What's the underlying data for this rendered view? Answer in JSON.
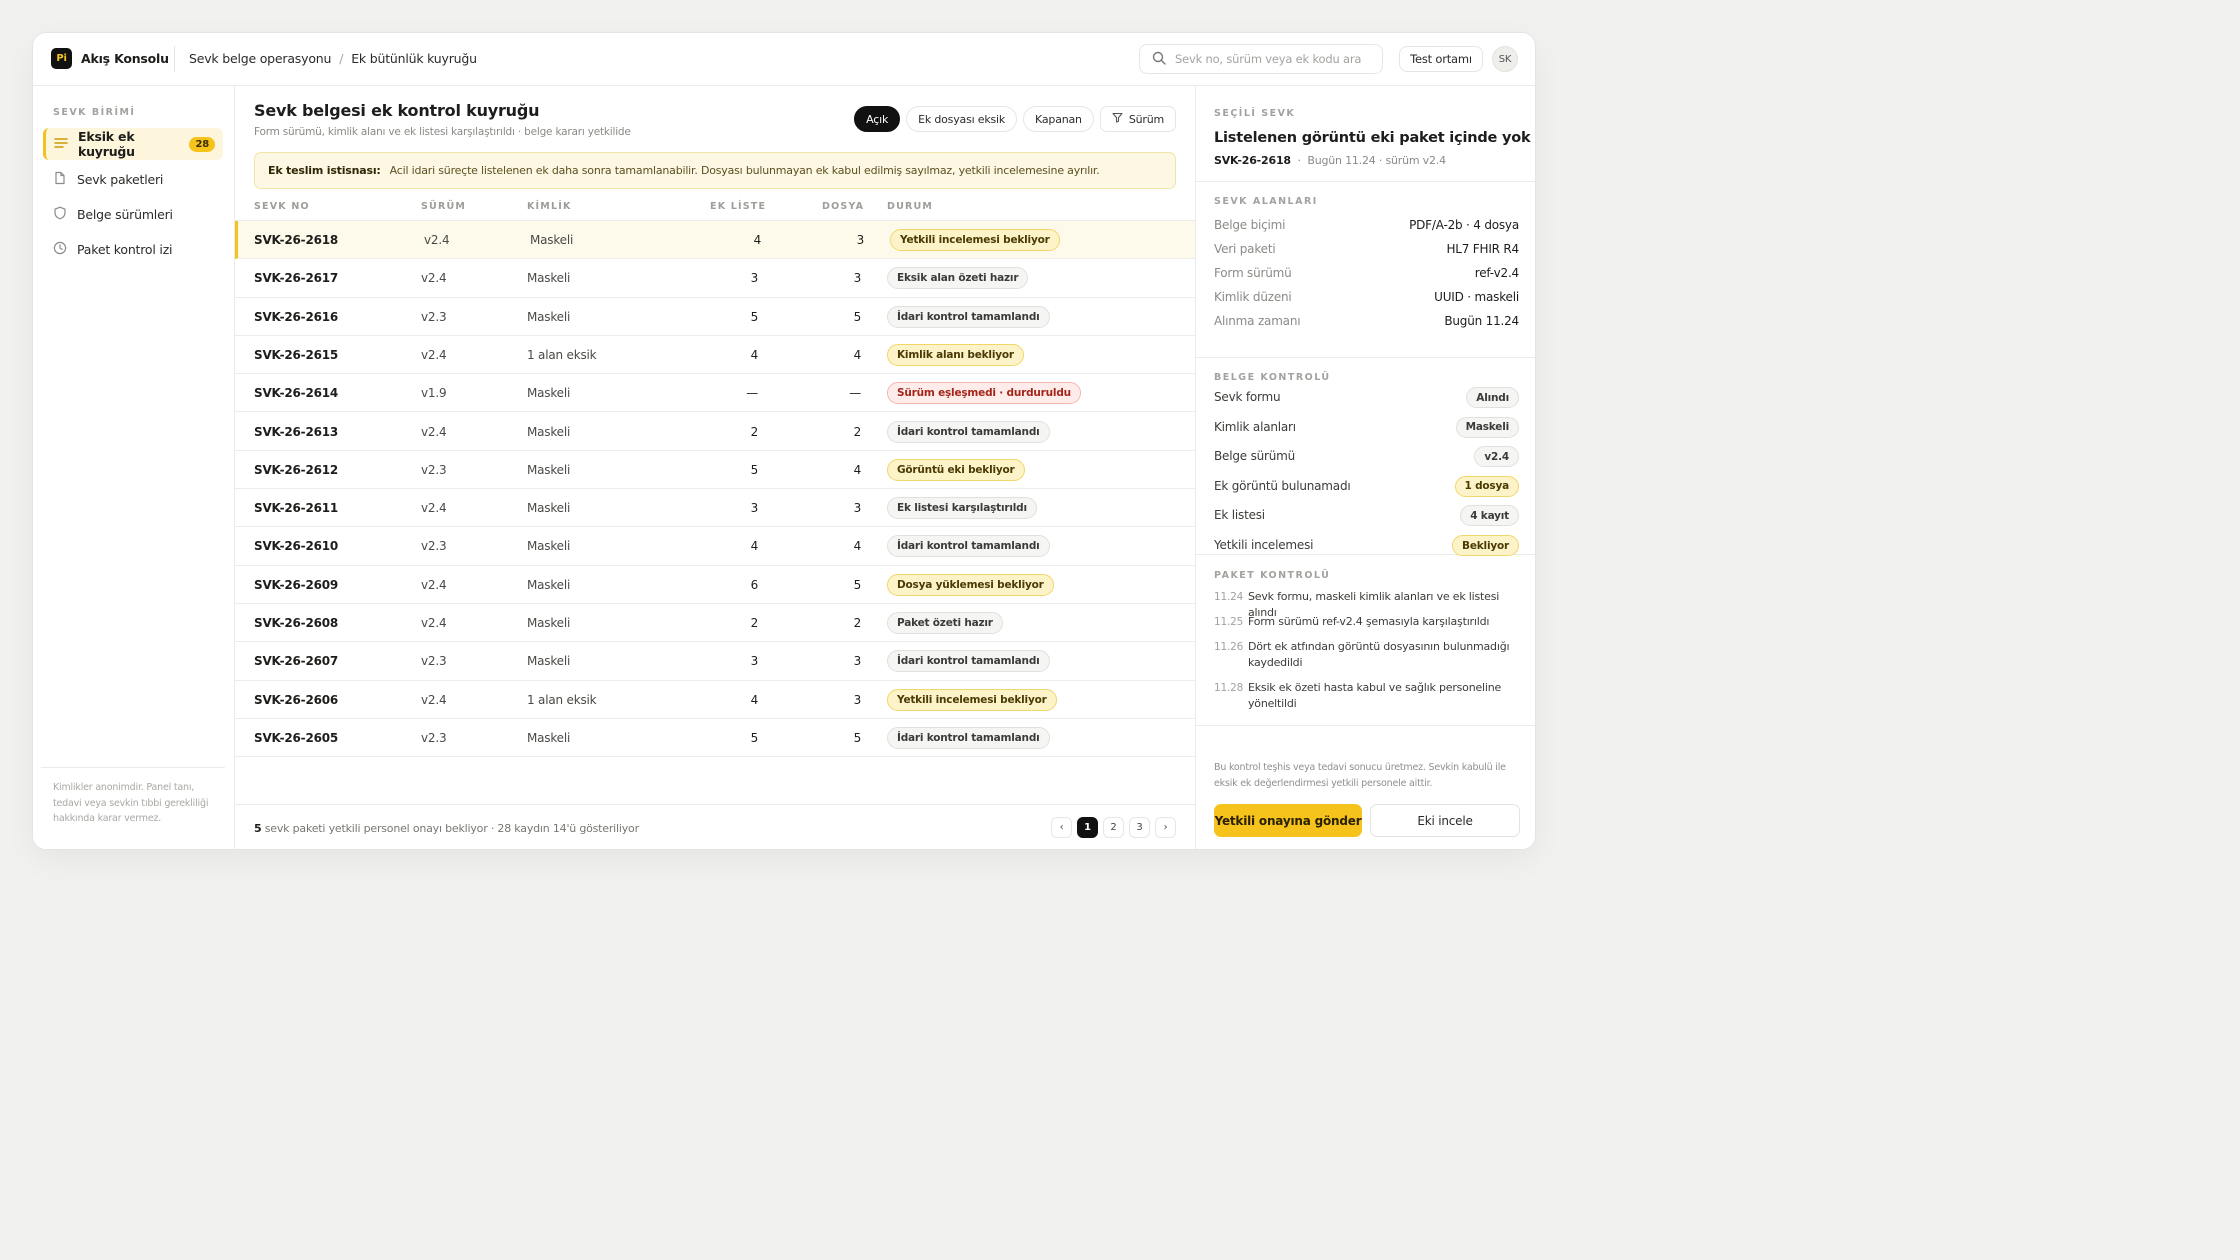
{
  "app": {
    "logo": "Pi",
    "name": "Akış Konsolu"
  },
  "breadcrumb": [
    "Sevk belge operasyonu",
    "/",
    "Ek bütünlük kuyruğu"
  ],
  "search": {
    "placeholder": "Sevk no, sürüm veya ek kodu ara"
  },
  "env_button": "Test ortamı",
  "user_initials": "SK",
  "sidebar": {
    "section": "SEVK BİRİMİ",
    "items": [
      {
        "label": "Eksik ek kuyruğu",
        "count": "28",
        "icon": "list-icon"
      },
      {
        "label": "Sevk paketleri",
        "icon": "document-icon"
      },
      {
        "label": "Belge sürümleri",
        "icon": "shield-icon"
      },
      {
        "label": "Paket kontrol izi",
        "icon": "clock-icon"
      }
    ],
    "footer": "Kimlikler anonimdir. Panel tanı, tedavi veya sevkin tıbbi gerekliliği hakkında karar vermez."
  },
  "main": {
    "title": "Sevk belgesi ek kontrol kuyruğu",
    "subtitle": "Form sürümü, kimlik alanı ve ek listesi karşılaştırıldı · belge kararı yetkilide",
    "filters": [
      "Açık",
      "Ek dosyası eksik",
      "Kapanan",
      "Sürüm"
    ],
    "banner": {
      "label": "Ek teslim istisnası:",
      "text": "Acil idari süreçte listelenen ek daha sonra tamamlanabilir. Dosyası bulunmayan ek kabul edilmiş sayılmaz, yetkili incelemesine ayrılır."
    },
    "columns": [
      "SEVK NO",
      "SÜRÜM",
      "KİMLİK",
      "EK LİSTE",
      "DOSYA",
      "DURUM"
    ],
    "rows": [
      {
        "id": "SVK-26-2618",
        "version": "v2.4",
        "identity": "Maskeli",
        "list": "4",
        "files": "3",
        "status": "Yetkili incelemesi bekliyor",
        "tone": "y"
      },
      {
        "id": "SVK-26-2617",
        "version": "v2.4",
        "identity": "Maskeli",
        "list": "3",
        "files": "3",
        "status": "Eksik alan özeti hazır",
        "tone": "g"
      },
      {
        "id": "SVK-26-2616",
        "version": "v2.3",
        "identity": "Maskeli",
        "list": "5",
        "files": "5",
        "status": "İdari kontrol tamamlandı",
        "tone": "g"
      },
      {
        "id": "SVK-26-2615",
        "version": "v2.4",
        "identity": "1 alan eksik",
        "list": "4",
        "files": "4",
        "status": "Kimlik alanı bekliyor",
        "tone": "y"
      },
      {
        "id": "SVK-26-2614",
        "version": "v1.9",
        "identity": "Maskeli",
        "list": "—",
        "files": "—",
        "status": "Sürüm eşleşmedi · durduruldu",
        "tone": "r"
      },
      {
        "id": "SVK-26-2613",
        "version": "v2.4",
        "identity": "Maskeli",
        "list": "2",
        "files": "2",
        "status": "İdari kontrol tamamlandı",
        "tone": "g"
      },
      {
        "id": "SVK-26-2612",
        "version": "v2.3",
        "identity": "Maskeli",
        "list": "5",
        "files": "4",
        "status": "Görüntü eki bekliyor",
        "tone": "y"
      },
      {
        "id": "SVK-26-2611",
        "version": "v2.4",
        "identity": "Maskeli",
        "list": "3",
        "files": "3",
        "status": "Ek listesi karşılaştırıldı",
        "tone": "g"
      },
      {
        "id": "SVK-26-2610",
        "version": "v2.3",
        "identity": "Maskeli",
        "list": "4",
        "files": "4",
        "status": "İdari kontrol tamamlandı",
        "tone": "g"
      },
      {
        "id": "SVK-26-2609",
        "version": "v2.4",
        "identity": "Maskeli",
        "list": "6",
        "files": "5",
        "status": "Dosya yüklemesi bekliyor",
        "tone": "y"
      },
      {
        "id": "SVK-26-2608",
        "version": "v2.4",
        "identity": "Maskeli",
        "list": "2",
        "files": "2",
        "status": "Paket özeti hazır",
        "tone": "g"
      },
      {
        "id": "SVK-26-2607",
        "version": "v2.3",
        "identity": "Maskeli",
        "list": "3",
        "files": "3",
        "status": "İdari kontrol tamamlandı",
        "tone": "g"
      },
      {
        "id": "SVK-26-2606",
        "version": "v2.4",
        "identity": "1 alan eksik",
        "list": "4",
        "files": "3",
        "status": "Yetkili incelemesi bekliyor",
        "tone": "y"
      },
      {
        "id": "SVK-26-2605",
        "version": "v2.3",
        "identity": "Maskeli",
        "list": "5",
        "files": "5",
        "status": "İdari kontrol tamamlandı",
        "tone": "g"
      }
    ],
    "footer": {
      "count": "5",
      "text": "sevk paketi yetkili personel onayı bekliyor · 28 kaydın 14'ü gösteriliyor"
    },
    "pager": {
      "prev": "‹",
      "pages": [
        "1",
        "2",
        "3"
      ],
      "next": "›"
    }
  },
  "detail": {
    "section": "SEÇİLİ SEVK",
    "title": "Listelenen görüntü eki paket içinde yok",
    "id": "SVK-26-2618",
    "meta": "Bugün 11.24 · sürüm v2.4",
    "fields_head": "SEVK ALANLARI",
    "fields": [
      {
        "k": "Belge biçimi",
        "v": "PDF/A-2b · 4 dosya"
      },
      {
        "k": "Veri paketi",
        "v": "HL7 FHIR R4"
      },
      {
        "k": "Form sürümü",
        "v": "ref-v2.4"
      },
      {
        "k": "Kimlik düzeni",
        "v": "UUID · maskeli"
      },
      {
        "k": "Alınma zamanı",
        "v": "Bugün 11.24"
      }
    ],
    "checks_head": "BELGE KONTROLÜ",
    "checks": [
      {
        "k": "Sevk formu",
        "v": "Alındı",
        "tone": "g"
      },
      {
        "k": "Kimlik alanları",
        "v": "Maskeli",
        "tone": "g"
      },
      {
        "k": "Belge sürümü",
        "v": "v2.4",
        "tone": "g"
      },
      {
        "k": "Ek görüntü bulunamadı",
        "v": "1 dosya",
        "tone": "y"
      },
      {
        "k": "Ek listesi",
        "v": "4 kayıt",
        "tone": "g"
      },
      {
        "k": "Yetkili incelemesi",
        "v": "Bekliyor",
        "tone": "y"
      }
    ],
    "log_head": "PAKET KONTROLÜ",
    "log": [
      {
        "t": "11.24",
        "d": "Sevk formu, maskeli kimlik alanları ve ek listesi alındı"
      },
      {
        "t": "11.25",
        "d": "Form sürümü ref-v2.4 şemasıyla karşılaştırıldı"
      },
      {
        "t": "11.26",
        "d": "Dört ek atfından görüntü dosyasının bulunmadığı kaydedildi"
      },
      {
        "t": "11.28",
        "d": "Eksik ek özeti hasta kabul ve sağlık personeline yöneltildi"
      }
    ],
    "note": "Bu kontrol teşhis veya tedavi sonucu üretmez. Sevkin kabulü ile eksik ek değerlendirmesi yetkili personele aittir.",
    "primary": "Yetkili onayına gönder",
    "secondary": "Eki incele"
  }
}
